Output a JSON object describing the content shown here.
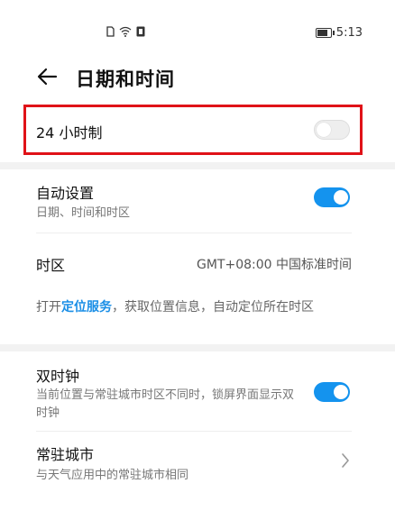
{
  "status_bar": {
    "time": "5:13",
    "left_icons": [
      "sim-card-icon",
      "wifi-icon",
      "notification-icon"
    ],
    "right_icons": [
      "battery-icon"
    ]
  },
  "header": {
    "title": "日期和时间"
  },
  "settings": {
    "hour24": {
      "label": "24 小时制",
      "enabled": false
    },
    "auto": {
      "label": "自动设置",
      "subtitle": "日期、时间和时区",
      "enabled": true
    },
    "timezone": {
      "label": "时区",
      "value": "GMT+08:00 中国标准时间"
    },
    "location_info": {
      "prefix": "打开",
      "link": "定位服务",
      "suffix": "，获取位置信息，自动定位所在时区"
    },
    "dual_clock": {
      "label": "双时钟",
      "subtitle": "当前位置与常驻城市时区不同时，锁屏界面显示双时钟",
      "enabled": true
    },
    "home_city": {
      "label": "常驻城市",
      "subtitle": "与天气应用中的常驻城市相同"
    }
  },
  "colors": {
    "accent": "#1493ee",
    "highlight_border": "#e01218",
    "link": "#1a8ee6"
  }
}
